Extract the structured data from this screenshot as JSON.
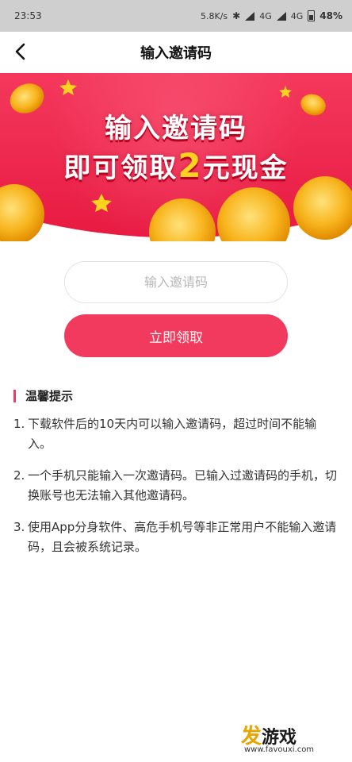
{
  "status_bar": {
    "time": "23:53",
    "net_speed": "5.8K/s",
    "net1": "4G",
    "net2": "4G",
    "battery": "48%"
  },
  "nav": {
    "back_icon": "chevron-left-icon",
    "title": "输入邀请码"
  },
  "banner": {
    "line1": "输入邀请码",
    "line2_prefix": "即可领取",
    "line2_number": "2",
    "line2_suffix": "元现金"
  },
  "form": {
    "placeholder": "输入邀请码",
    "value": "",
    "submit_label": "立即领取"
  },
  "tips": {
    "title": "温馨提示",
    "items": [
      {
        "num": "1.",
        "text": "下载软件后的10天内可以输入邀请码，超过时间不能输入。"
      },
      {
        "num": "2.",
        "text": "一个手机只能输入一次邀请码。已输入过邀请码的手机，切换账号也无法输入其他邀请码。"
      },
      {
        "num": "3.",
        "text": "使用App分身软件、高危手机号等非正常用户不能输入邀请码，且会被系统记录。"
      }
    ]
  },
  "watermark": {
    "logo_text_1": "发",
    "logo_text_2": "游戏",
    "url": "www.favouxi.com"
  },
  "colors": {
    "accent": "#f23a5e",
    "banner_red": "#f0284e",
    "gold": "#ffd21f"
  }
}
